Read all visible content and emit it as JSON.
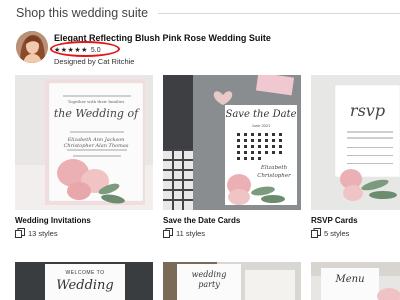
{
  "section": {
    "title": "Shop this wedding suite"
  },
  "suite": {
    "title": "Elegant Reflecting Blush Pink Rose Wedding Suite",
    "stars": "★★★★★",
    "rating": "5.0",
    "designer_line": "Designed by Cat Ritchie"
  },
  "cards": [
    {
      "label": "Wedding Invitations",
      "styles": "13 styles"
    },
    {
      "label": "Save the Date Cards",
      "styles": "11 styles"
    },
    {
      "label": "RSVP Cards",
      "styles": "5 styles"
    }
  ],
  "thumbnails": {
    "invitation": {
      "line1": "Together with their families",
      "line2": "the Wedding of",
      "name1": "Elizabeth Ann Jackson",
      "name2": "Christopher Alan Thomas"
    },
    "save_the_date": {
      "title": "Save the Date",
      "date": "June 2021",
      "weekdays": "S M T W T F S",
      "name1": "Elizabeth",
      "name2": "Christopher"
    },
    "rsvp": {
      "title": "rsvp"
    }
  },
  "row2": [
    {
      "text1": "WELCOME TO",
      "text2": "Wedding"
    },
    {
      "text1": "wedding",
      "text2": "party"
    },
    {
      "text1": "Menu",
      "text2": ""
    }
  ]
}
